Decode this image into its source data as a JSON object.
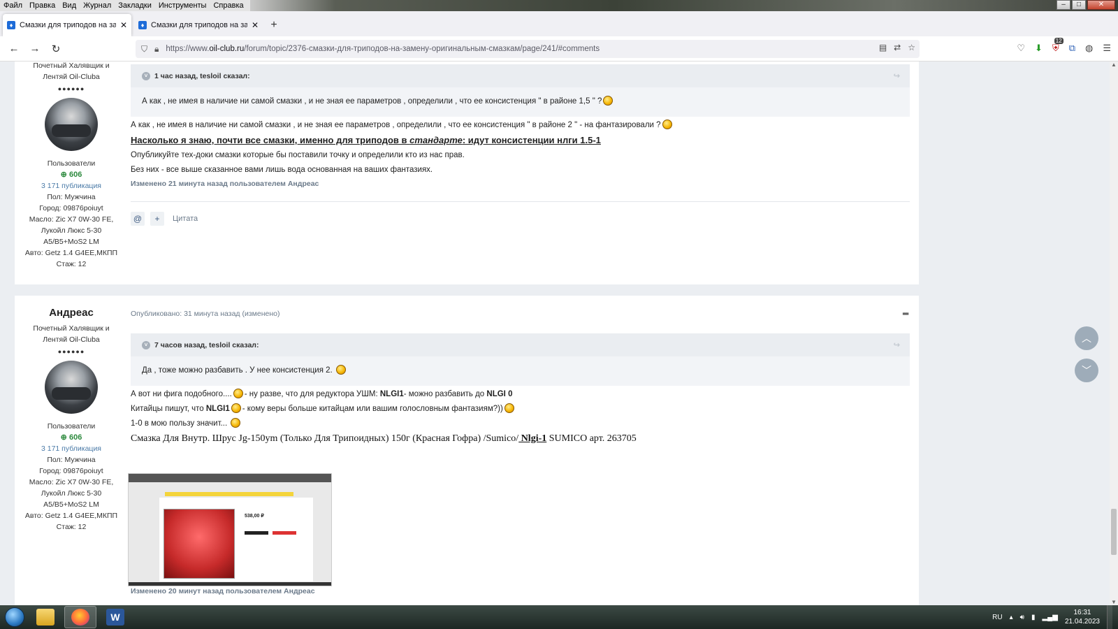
{
  "menubar": {
    "items": [
      "Файл",
      "Правка",
      "Вид",
      "Журнал",
      "Закладки",
      "Инструменты",
      "Справка"
    ]
  },
  "tabs": [
    {
      "title": "Смазки для триподов на замен",
      "active": true,
      "icon": "droplet-icon"
    },
    {
      "title": "Смазки для триподов на замен",
      "active": false,
      "icon": "droplet-icon"
    }
  ],
  "navbar": {
    "url_prefix": "https://www.",
    "url_domain": "oil-club.ru",
    "url_rest": "/forum/topic/2376-смазки-для-триподов-на-замену-оригинальным-смазкам/page/241/#comments"
  },
  "posts": [
    {
      "author": {
        "title_line1": "Почетный Халявщик и",
        "title_line2": "Лентяй Oil-Cluba",
        "dots": "●●●●●●",
        "group": "Пользователи",
        "reputation": "606",
        "publications": "3 171 публикация",
        "info": [
          "Пол: Мужчина",
          "Город: 09876poiuyt",
          "Масло: Zic X7 0W-30 FE,",
          "Лукойл Люкс 5-30",
          "A5/B5+MoS2 LM",
          "Авто: Getz 1.4 G4EE,МКПП",
          "Стаж: 12"
        ]
      },
      "quote": {
        "header": "1 час назад, tesloil сказал:",
        "text": "А как , не имея в наличие ни самой смазки , и не зная ее параметров , определили , что ее консистенция            \" в районе 1,5 \" ?"
      },
      "lines": {
        "l1": "А как , не имея в наличие ни самой смазки , и не зная ее параметров , определили , что ее консистенция            \" в районе 2 \" - на фантазировали ?",
        "bold_link_part1": "Насколько я знаю,  почти все смазки,  именно для триподов в ",
        "bold_link_italic": "стандарте",
        "bold_link_part2": ":   идут консистенции нлги 1.5-1",
        "l3": "Опубликуйте тех-доки смазки которые бы поставили точку и определили кто из нас прав.",
        "l4": "Без них - все выше сказанное вами лишь вода основанная на ваших фантазиях.",
        "edit_note": "Изменено 21 минута назад пользователем Андреас"
      },
      "controls": {
        "quote_label": "Цитата"
      }
    },
    {
      "author": {
        "name": "Андреас",
        "title_line1": "Почетный Халявщик и",
        "title_line2": "Лентяй Oil-Cluba",
        "dots": "●●●●●●",
        "group": "Пользователи",
        "reputation": "606",
        "publications": "3 171 публикация",
        "info": [
          "Пол: Мужчина",
          "Город: 09876poiuyt",
          "Масло: Zic X7 0W-30 FE,",
          "Лукойл Люкс 5-30",
          "A5/B5+MoS2 LM",
          "Авто: Getz 1.4 G4EE,МКПП",
          "Стаж: 12"
        ]
      },
      "meta": "Опубликовано: 31 минута назад (изменено)",
      "quote": {
        "header": "7 часов назад, tesloil сказал:",
        "text": "Да , тоже можно разбавить . У нее консистенция 2."
      },
      "lines": {
        "l1_a": "А вот ни фига подобного....",
        "l1_b": "-     ну разве,  что для редуктора УШМ: ",
        "l1_c": "NLGI1",
        "l1_d": "- можно разбавить до ",
        "l1_e": "NLGI 0",
        "l2_a": "Китайцы пишут, что ",
        "l2_b": "NLGI1",
        "l2_c": "- кому веры больше китайцам или вашим голословным фантазиям?))",
        "l3": "1-0 в мою пользу значит...",
        "serif_a": "Смазка Для Внутр. Шрус Jg-150ym (Только Для Трипоидных) 150г (Красная Гофра) /Sumico/",
        "serif_link": " Nlgi-1",
        "serif_b": " SUMICO арт. 263705",
        "screenshot_price": "538,00 ₽",
        "edit_note": "Изменено 20 минут назад пользователем Андреас"
      }
    }
  ],
  "taskbar": {
    "lang": "RU",
    "time": "16:31",
    "date": "21.04.2023"
  },
  "colors": {
    "page_bg": "#ebeef2",
    "reputation": "#2d8a3e",
    "link_meta": "#6b7a8a"
  }
}
